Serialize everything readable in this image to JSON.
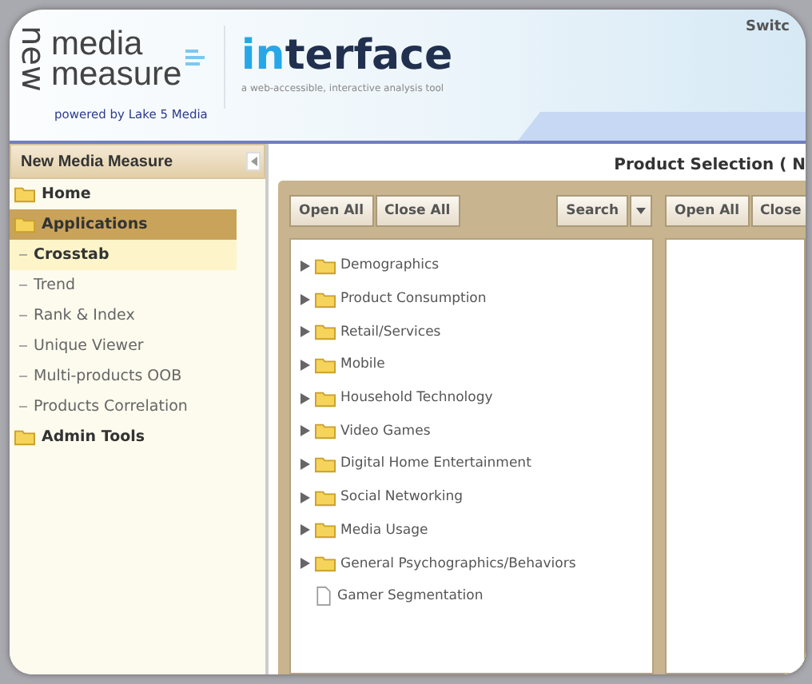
{
  "header": {
    "logo": {
      "vertical": "new",
      "line_1": "media",
      "line_2": "measure"
    },
    "app_title": {
      "accent": "in",
      "rest": "terface"
    },
    "tagline": "a web-accessible, interactive analysis tool",
    "powered_by": "powered by Lake 5 Media",
    "top_link": "Switc"
  },
  "sidebar": {
    "title": "New Media Measure",
    "items": [
      {
        "label": "Home",
        "kind": "folder",
        "selected": false
      },
      {
        "label": "Applications",
        "kind": "folder",
        "selected": true,
        "children": [
          {
            "label": "Crosstab",
            "selected": true
          },
          {
            "label": "Trend",
            "selected": false
          },
          {
            "label": "Rank & Index",
            "selected": false
          },
          {
            "label": "Unique Viewer",
            "selected": false
          },
          {
            "label": "Multi-products OOB",
            "selected": false
          },
          {
            "label": "Products Correlation",
            "selected": false
          }
        ]
      },
      {
        "label": "Admin Tools",
        "kind": "folder",
        "selected": false
      }
    ]
  },
  "main": {
    "title": "Product Selection ( N",
    "left_toolbar": [
      "Open All",
      "Close All"
    ],
    "search_button": "Search",
    "right_toolbar": [
      "Open All",
      "Close "
    ],
    "tree": [
      {
        "label": "Demographics",
        "kind": "folder",
        "expanded": false
      },
      {
        "label": "Product Consumption",
        "kind": "folder",
        "expanded": false
      },
      {
        "label": "Retail/Services",
        "kind": "folder",
        "expanded": false
      },
      {
        "label": "Mobile",
        "kind": "folder",
        "expanded": false
      },
      {
        "label": "Household Technology",
        "kind": "folder",
        "expanded": false
      },
      {
        "label": "Video Games",
        "kind": "folder",
        "expanded": false
      },
      {
        "label": "Digital Home Entertainment",
        "kind": "folder",
        "expanded": false
      },
      {
        "label": "Social Networking",
        "kind": "folder",
        "expanded": false
      },
      {
        "label": "Media Usage",
        "kind": "folder",
        "expanded": false
      },
      {
        "label": "General Psychographics/Behaviors",
        "kind": "folder",
        "expanded": false
      },
      {
        "label": "Gamer Segmentation",
        "kind": "file"
      }
    ]
  }
}
